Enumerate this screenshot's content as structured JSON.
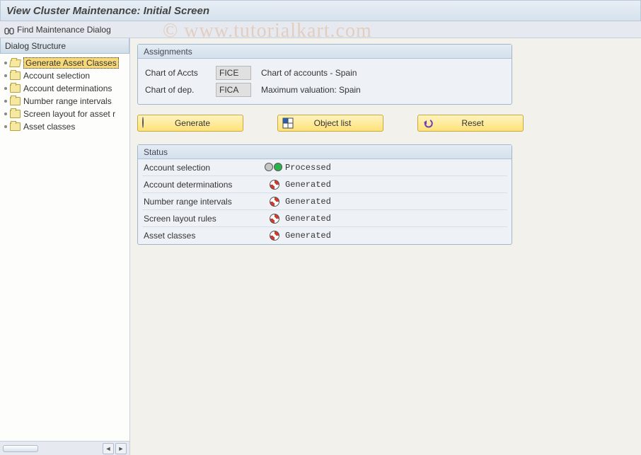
{
  "title": "View Cluster Maintenance: Initial Screen",
  "toolbar": {
    "find_label": "Find Maintenance Dialog"
  },
  "sidebar": {
    "header": "Dialog Structure",
    "items": [
      {
        "label": "Generate Asset Classes",
        "selected": true,
        "open": true
      },
      {
        "label": "Account selection",
        "selected": false,
        "open": false
      },
      {
        "label": "Account determinations",
        "selected": false,
        "open": false
      },
      {
        "label": "Number range intervals",
        "selected": false,
        "open": false
      },
      {
        "label": "Screen layout for asset r",
        "selected": false,
        "open": false
      },
      {
        "label": "Asset classes",
        "selected": false,
        "open": false
      }
    ]
  },
  "assignments": {
    "title": "Assignments",
    "rows": [
      {
        "label": "Chart of Accts",
        "value": "FICE",
        "desc": "Chart of accounts - Spain"
      },
      {
        "label": "Chart of dep.",
        "value": "FICA",
        "desc": "Maximum valuation: Spain"
      }
    ]
  },
  "buttons": {
    "generate": {
      "label": "Generate",
      "icon": "generate-icon"
    },
    "objectlist": {
      "label": "Object list",
      "icon": "grid-icon"
    },
    "reset": {
      "label": "Reset",
      "icon": "undo-icon"
    }
  },
  "status": {
    "title": "Status",
    "rows": [
      {
        "label": "Account selection",
        "state": "Processed",
        "kind": "processed"
      },
      {
        "label": "Account determinations",
        "state": "Generated",
        "kind": "generated"
      },
      {
        "label": "Number range intervals",
        "state": "Generated",
        "kind": "generated"
      },
      {
        "label": "Screen layout rules",
        "state": "Generated",
        "kind": "generated"
      },
      {
        "label": "Asset classes",
        "state": "Generated",
        "kind": "generated"
      }
    ]
  },
  "watermark": "© www.tutorialkart.com"
}
